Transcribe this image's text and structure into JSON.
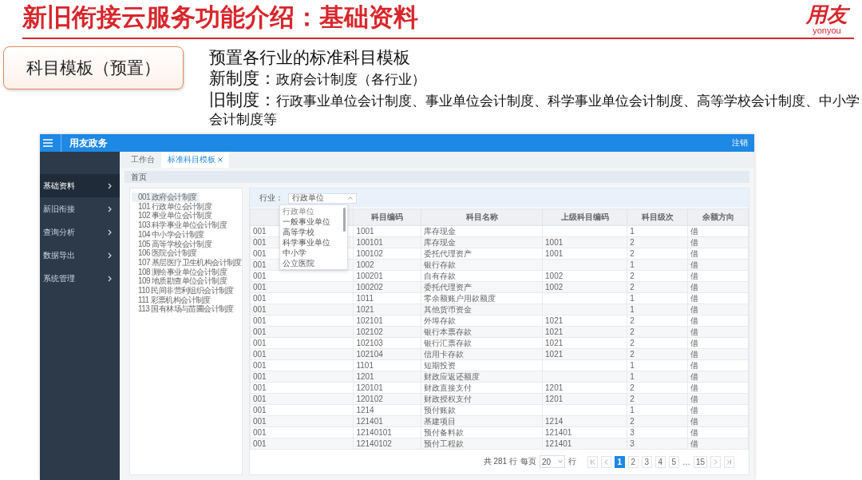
{
  "slide": {
    "title": "新旧衔接云服务功能介绍：基础资料",
    "logo": {
      "mark": "用友",
      "wordmark": "yonyou"
    }
  },
  "intro": {
    "tag": "科目模板（预置）",
    "heading": "预置各行业的标准科目模板",
    "lines": [
      {
        "label": "新制度：",
        "text": "政府会计制度（各行业）"
      },
      {
        "label": "旧制度：",
        "text": "行政事业单位会计制度、事业单位会计制度、科学事业单位会计制度、高等学校会计制度、中小学会计制度等"
      }
    ]
  },
  "app": {
    "brand": "用友政务",
    "logout": "注销",
    "sidebar": [
      {
        "label": "基础资料",
        "selected": true
      },
      {
        "label": "新旧衔接",
        "selected": false
      },
      {
        "label": "查询分析",
        "selected": false
      },
      {
        "label": "数据导出",
        "selected": false
      },
      {
        "label": "系统管理",
        "selected": false
      }
    ],
    "tabs": [
      {
        "label": "工作台",
        "selected": false,
        "closable": false
      },
      {
        "label": "标准科目模板",
        "selected": true,
        "closable": true
      }
    ],
    "breadcrumb": "首页",
    "templates": [
      {
        "label": "001 政府会计制度",
        "selected": true
      },
      {
        "label": "101 行政单位会计制度",
        "selected": false
      },
      {
        "label": "102 事业单位会计制度",
        "selected": false
      },
      {
        "label": "103 科学事业单位会计制度",
        "selected": false
      },
      {
        "label": "104 中小学会计制度",
        "selected": false
      },
      {
        "label": "105 高等学校会计制度",
        "selected": false
      },
      {
        "label": "106 医院会计制度",
        "selected": false
      },
      {
        "label": "107 基层医疗卫生机构会计制度",
        "selected": false
      },
      {
        "label": "108 测绘事业单位会计制度",
        "selected": false
      },
      {
        "label": "109 地质勘查单位会计制度",
        "selected": false
      },
      {
        "label": "110 民间非营利组织会计制度",
        "selected": false
      },
      {
        "label": "111 彩票机构会计制度",
        "selected": false
      },
      {
        "label": "113 国有林场与苗圃会计制度",
        "selected": false
      }
    ],
    "filter": {
      "label": "行业：",
      "value": "行政单位",
      "expanded": true,
      "options": [
        {
          "label": "行政单位",
          "selected": true
        },
        {
          "label": "一般事业单位",
          "selected": false
        },
        {
          "label": "高等学校",
          "selected": false
        },
        {
          "label": "科学事业单位",
          "selected": false
        },
        {
          "label": "中小学",
          "selected": false
        },
        {
          "label": "公立医院",
          "selected": false
        }
      ]
    },
    "table": {
      "columns": [
        "",
        "科目编码",
        "科目名称",
        "上级科目编码",
        "科目级次",
        "余额方向"
      ],
      "rows": [
        [
          "001",
          "1001",
          "库存现金",
          "",
          "1",
          "借"
        ],
        [
          "001",
          "100101",
          "库存现金",
          "1001",
          "2",
          "借"
        ],
        [
          "001",
          "100102",
          "委托代理资产",
          "1001",
          "2",
          "借"
        ],
        [
          "001",
          "1002",
          "银行存款",
          "",
          "1",
          "借"
        ],
        [
          "001",
          "100201",
          "自有存款",
          "1002",
          "2",
          "借"
        ],
        [
          "001",
          "100202",
          "委托代理资产",
          "1002",
          "2",
          "借"
        ],
        [
          "001",
          "1011",
          "零余额账户用款额度",
          "",
          "1",
          "借"
        ],
        [
          "001",
          "1021",
          "其他货币资金",
          "",
          "1",
          "借"
        ],
        [
          "001",
          "102101",
          "外埠存款",
          "1021",
          "2",
          "借"
        ],
        [
          "001",
          "102102",
          "银行本票存款",
          "1021",
          "2",
          "借"
        ],
        [
          "001",
          "102103",
          "银行汇票存款",
          "1021",
          "2",
          "借"
        ],
        [
          "001",
          "102104",
          "信用卡存款",
          "1021",
          "2",
          "借"
        ],
        [
          "001",
          "1101",
          "短期投资",
          "",
          "1",
          "借"
        ],
        [
          "001",
          "1201",
          "财政应返还额度",
          "",
          "1",
          "借"
        ],
        [
          "001",
          "120101",
          "财政直接支付",
          "1201",
          "2",
          "借"
        ],
        [
          "001",
          "120102",
          "财政授权支付",
          "1201",
          "2",
          "借"
        ],
        [
          "001",
          "1214",
          "预付账款",
          "",
          "1",
          "借"
        ],
        [
          "001",
          "121401",
          "基建项目",
          "1214",
          "2",
          "借"
        ],
        [
          "001",
          "12140101",
          "预付备料款",
          "121401",
          "3",
          "借"
        ],
        [
          "001",
          "12140102",
          "预付工程款",
          "121401",
          "3",
          "借"
        ]
      ]
    },
    "pagination": {
      "total": "共 281 行",
      "per_page_label": "每页",
      "per_page": "20",
      "unit": "行",
      "pages": [
        {
          "label": "1",
          "kind": "page",
          "selected": true
        },
        {
          "label": "2",
          "kind": "page",
          "selected": false
        },
        {
          "label": "3",
          "kind": "page",
          "selected": false
        },
        {
          "label": "4",
          "kind": "page",
          "selected": false
        },
        {
          "label": "5",
          "kind": "page",
          "selected": false
        },
        {
          "label": "…",
          "kind": "gap"
        },
        {
          "label": "15",
          "kind": "page",
          "selected": false
        }
      ]
    }
  }
}
